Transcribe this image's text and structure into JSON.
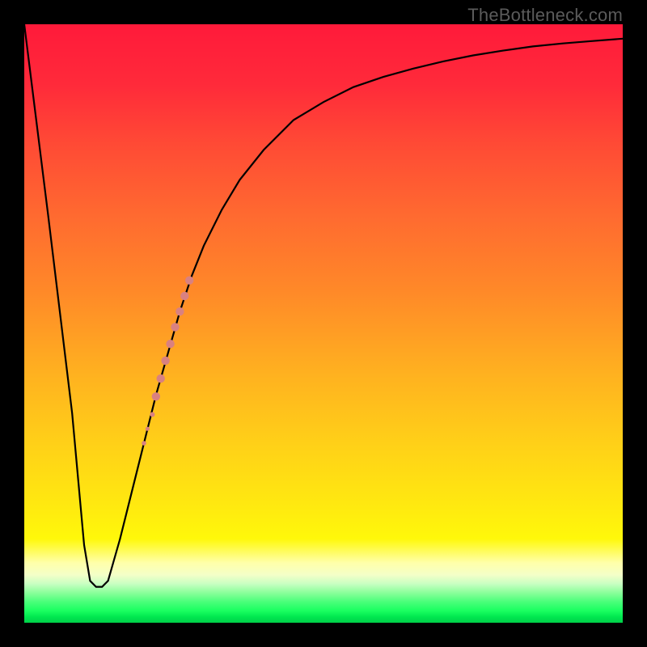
{
  "watermark": "TheBottleneck.com",
  "colors": {
    "frame": "#000000",
    "curve": "#000000",
    "dots": "#d98180",
    "gradient_stops": [
      "#ff1a3a",
      "#ff2a3a",
      "#ff4a35",
      "#ff6a30",
      "#ff8a28",
      "#ffb020",
      "#ffd018",
      "#ffe810",
      "#fff80a",
      "#ffffaa",
      "#f4ffc8",
      "#c8ffc2",
      "#8aff9a",
      "#4aff7a",
      "#1aff60",
      "#00e850",
      "#00d048"
    ]
  },
  "chart_data": {
    "type": "line",
    "title": "",
    "xlabel": "",
    "ylabel": "",
    "xlim": [
      0,
      100
    ],
    "ylim": [
      0,
      100
    ],
    "grid": "off",
    "legend": "none",
    "series": [
      {
        "name": "curve",
        "x": [
          0,
          4,
          8,
          10,
          11,
          12,
          13,
          14,
          16,
          18,
          20,
          22,
          24,
          26,
          28,
          30,
          33,
          36,
          40,
          45,
          50,
          55,
          60,
          65,
          70,
          75,
          80,
          85,
          90,
          95,
          100
        ],
        "y": [
          100,
          68,
          35,
          13,
          7,
          6,
          6,
          7,
          14,
          22,
          30,
          38,
          45,
          52,
          58,
          63,
          69,
          74,
          79,
          84,
          87,
          89.5,
          91.2,
          92.6,
          93.8,
          94.8,
          95.6,
          96.3,
          96.8,
          97.2,
          97.6
        ],
        "note": "y is height above bottom as a percentage; relative shape only, no visible scale in image"
      }
    ],
    "scatter": {
      "name": "highlighted-segment",
      "points": [
        {
          "x": 20.0,
          "y": 30.0,
          "r": 2.8
        },
        {
          "x": 20.6,
          "y": 32.4,
          "r": 2.6
        },
        {
          "x": 21.4,
          "y": 34.8,
          "r": 3.0
        },
        {
          "x": 22.0,
          "y": 37.8,
          "r": 5.2
        },
        {
          "x": 22.8,
          "y": 40.8,
          "r": 5.2
        },
        {
          "x": 23.6,
          "y": 43.8,
          "r": 5.2
        },
        {
          "x": 24.4,
          "y": 46.6,
          "r": 5.2
        },
        {
          "x": 25.2,
          "y": 49.4,
          "r": 5.2
        },
        {
          "x": 26.0,
          "y": 52.0,
          "r": 5.2
        },
        {
          "x": 26.8,
          "y": 54.6,
          "r": 5.2
        },
        {
          "x": 27.6,
          "y": 57.2,
          "r": 5.2
        }
      ],
      "note": "points drawn on top of curve; r is relative radius"
    }
  }
}
